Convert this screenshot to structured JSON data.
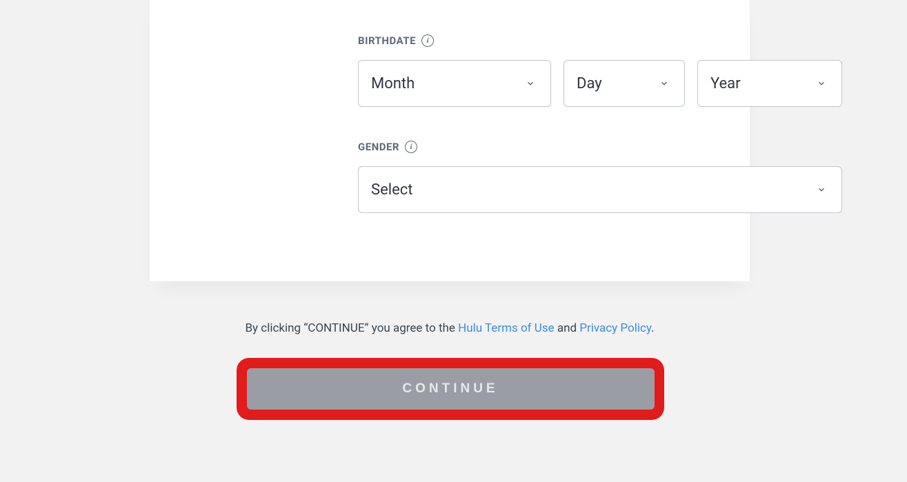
{
  "birthdate": {
    "label": "BIRTHDATE",
    "month": "Month",
    "day": "Day",
    "year": "Year"
  },
  "gender": {
    "label": "GENDER",
    "placeholder": "Select"
  },
  "legal": {
    "prefix": "By clicking “CONTINUE” you agree to the ",
    "terms_link": "Hulu Terms of Use",
    "and": " and ",
    "privacy_link": "Privacy Policy",
    "suffix": "."
  },
  "continue_label": "CONTINUE"
}
